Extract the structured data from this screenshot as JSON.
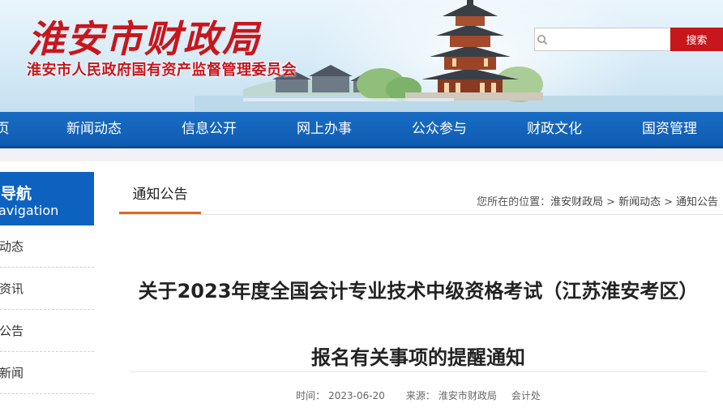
{
  "header": {
    "title": "淮安市财政局",
    "subtitle": "淮安市人民政府国有资产监督管理委员会",
    "search": {
      "placeholder": "",
      "button_label": "搜索"
    }
  },
  "nav": {
    "items": [
      {
        "label": "页"
      },
      {
        "label": "新闻动态"
      },
      {
        "label": "信息公开"
      },
      {
        "label": "网上办事"
      },
      {
        "label": "公众参与"
      },
      {
        "label": "财政文化"
      },
      {
        "label": "国资管理"
      }
    ]
  },
  "sidebar": {
    "heading_cn": "内导航",
    "heading_en": "Navigation",
    "items": [
      {
        "label": "作动态"
      },
      {
        "label": "经资讯"
      },
      {
        "label": "知公告"
      },
      {
        "label": "片新闻"
      }
    ]
  },
  "content": {
    "section_tab": "通知公告",
    "breadcrumb": {
      "prefix": "您所在的位置：",
      "items": [
        "淮安财政局",
        "新闻动态",
        "通知公告"
      ],
      "separator": ">"
    },
    "article": {
      "title": "关于2023年度全国会计专业技术中级资格考试（江苏淮安考区）报名有关事项的提醒通知",
      "time_label": "时间：",
      "time": "2023-06-20",
      "source_label": "来源：",
      "source": "淮安市财政局",
      "department": "会计处"
    }
  },
  "colors": {
    "brand_red": "#c8161d",
    "nav_blue": "#0f5cb2",
    "sidebar_blue": "#0d62c0",
    "tab_accent": "#e0671d"
  }
}
